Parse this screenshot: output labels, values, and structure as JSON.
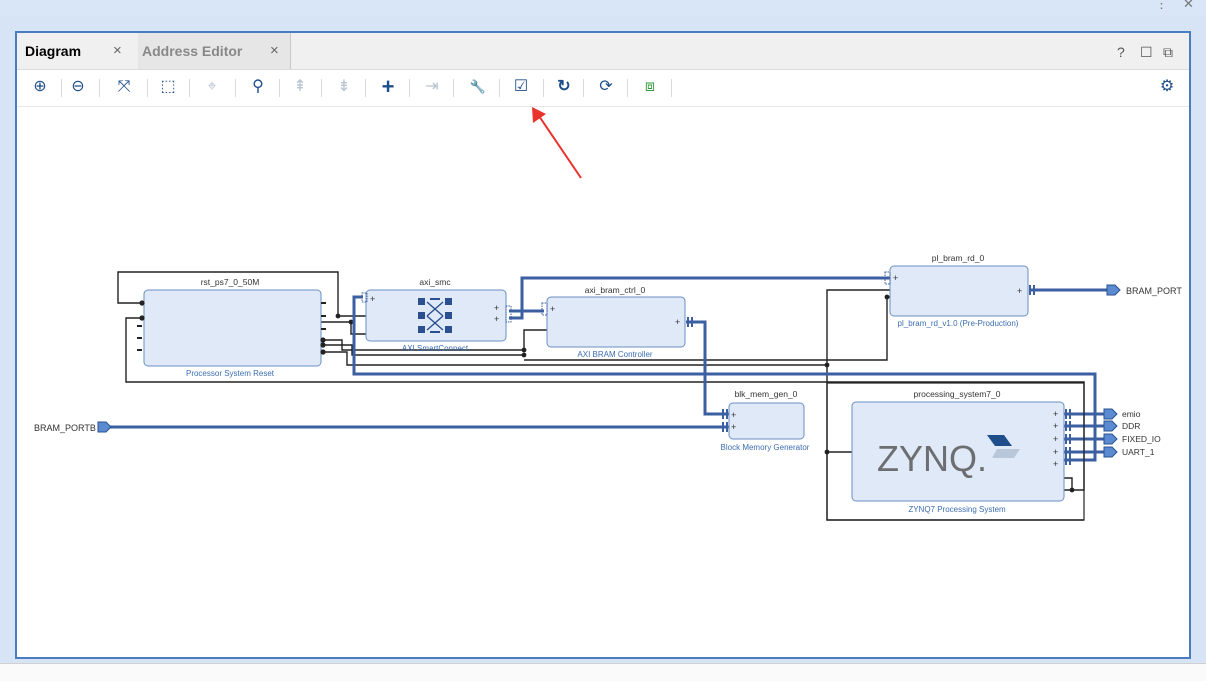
{
  "tabs": [
    {
      "label": "Diagram",
      "close": "×"
    },
    {
      "label": "Address Editor",
      "close": "×"
    }
  ],
  "window_controls": {
    "help": "?",
    "restore": "☐",
    "float": "⧉"
  },
  "top_controls": {
    "more": "⋮",
    "close": "✕"
  },
  "toolbar": {
    "buttons": [
      {
        "name": "zoom-in-icon",
        "glyph": "⊕"
      },
      {
        "name": "zoom-out-icon",
        "glyph": "⊖"
      },
      {
        "name": "zoom-fit-icon",
        "glyph": "⤧"
      },
      {
        "name": "zoom-area-icon",
        "glyph": "⬚"
      },
      {
        "name": "auto-fit-selection-icon",
        "glyph": "⌖"
      },
      {
        "name": "search-icon",
        "glyph": "⚲"
      },
      {
        "name": "collapse-all-icon",
        "glyph": "⇞"
      },
      {
        "name": "expand-all-icon",
        "glyph": "⇟"
      },
      {
        "name": "add-ip-icon",
        "glyph": "+"
      },
      {
        "name": "make-connection-icon",
        "glyph": "⇥"
      },
      {
        "name": "customize-wrench-icon",
        "glyph": "🔧"
      },
      {
        "name": "validate-design-icon",
        "glyph": "☑"
      },
      {
        "name": "regenerate-layout-icon",
        "glyph": "↻"
      },
      {
        "name": "optimize-routing-icon",
        "glyph": "⟳"
      },
      {
        "name": "add-module-icon",
        "glyph": "⧈"
      },
      {
        "name": "settings-gear-icon",
        "glyph": "⚙"
      }
    ]
  },
  "diagram": {
    "blocks": {
      "rst": {
        "instance": "rst_ps7_0_50M",
        "type": "Processor System Reset"
      },
      "smc": {
        "instance": "axi_smc",
        "type": "AXI SmartConnect"
      },
      "bram_ctrl": {
        "instance": "axi_bram_ctrl_0",
        "type": "AXI BRAM Controller"
      },
      "pl_bram": {
        "instance": "pl_bram_rd_0",
        "type": "pl_bram_rd_v1.0 (Pre-Production)"
      },
      "blk_mem": {
        "instance": "blk_mem_gen_0",
        "type": "Block Memory Generator"
      },
      "ps7": {
        "instance": "processing_system7_0",
        "type": "ZYNQ7 Processing System",
        "logo": "ZYNQ."
      }
    },
    "ports": {
      "bram_port": "BRAM_PORT",
      "bram_portb": "BRAM_PORTB"
    },
    "ps7_ports": [
      "emio",
      "DDR",
      "FIXED_IO",
      "UART_1"
    ],
    "plus": "+"
  },
  "colors": {
    "accent": "#1f4f8b",
    "block_fill": "#dfe9f7",
    "block_border": "#6b8fc2",
    "annotation": "#e8322b"
  }
}
